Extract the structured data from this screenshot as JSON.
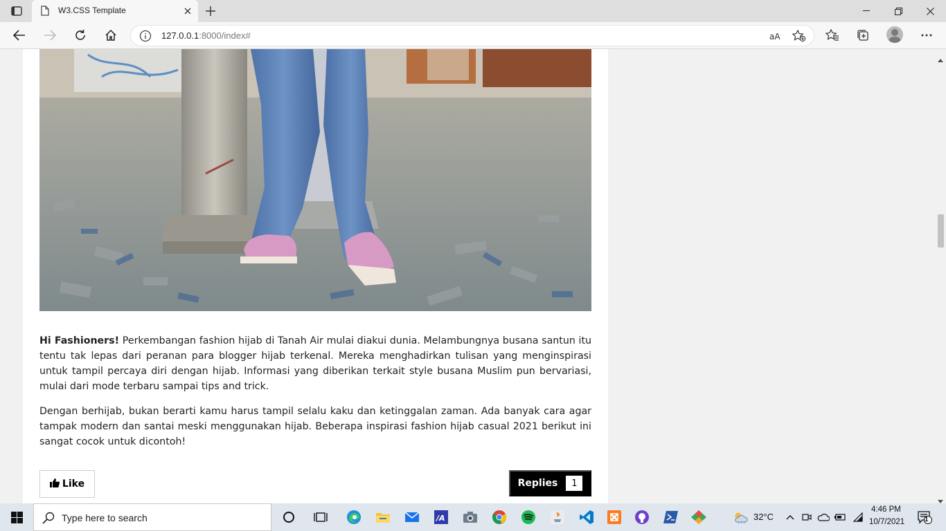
{
  "browser": {
    "tab_title": "W3.CSS Template",
    "url_host": "127.0.0.1",
    "url_path": ":8000/index#"
  },
  "article": {
    "intro_bold": "Hi Fashioners!",
    "p1_rest": " Perkembangan fashion hijab di Tanah Air mulai diakui dunia. Melambungnya busana santun itu tentu tak lepas dari peranan para blogger hijab terkenal. Mereka menghadirkan tulisan yang menginspirasi untuk tampil percaya diri dengan hijab. Informasi yang diberikan terkait style busana Muslim pun bervariasi, mulai dari mode terbaru sampai tips and trick.",
    "p2": "Dengan berhijab, bukan berarti kamu harus tampil selalu kaku dan ketinggalan zaman. Ada banyak cara agar tampak modern dan santai meski menggunakan hijab. Beberapa inspirasi fashion hijab casual 2021 berikut ini sangat cocok untuk dicontoh!",
    "like_label": "Like",
    "replies_label": "Replies",
    "replies_count": "1"
  },
  "taskbar": {
    "search_placeholder": "Type here to search",
    "weather": "32°C",
    "time": "4:46 PM",
    "date": "10/7/2021",
    "notification_count": "1"
  },
  "icons": {
    "tab_actions": "tab-actions-icon",
    "favicon": "page-icon",
    "back": "back-arrow-icon",
    "forward": "forward-arrow-icon",
    "refresh": "refresh-icon",
    "home": "home-icon",
    "site_info": "info-icon",
    "read_aloud": "read-aloud-icon",
    "add_favorite": "add-favorite-icon",
    "favorites": "favorites-icon",
    "collections": "collections-icon",
    "profile": "profile-avatar",
    "more": "more-icon"
  },
  "colors": {
    "replies_bg": "#000000",
    "page_bg": "#f1f1f1",
    "card_bg": "#ffffff",
    "taskbar_bg": "#dfe6ee"
  }
}
